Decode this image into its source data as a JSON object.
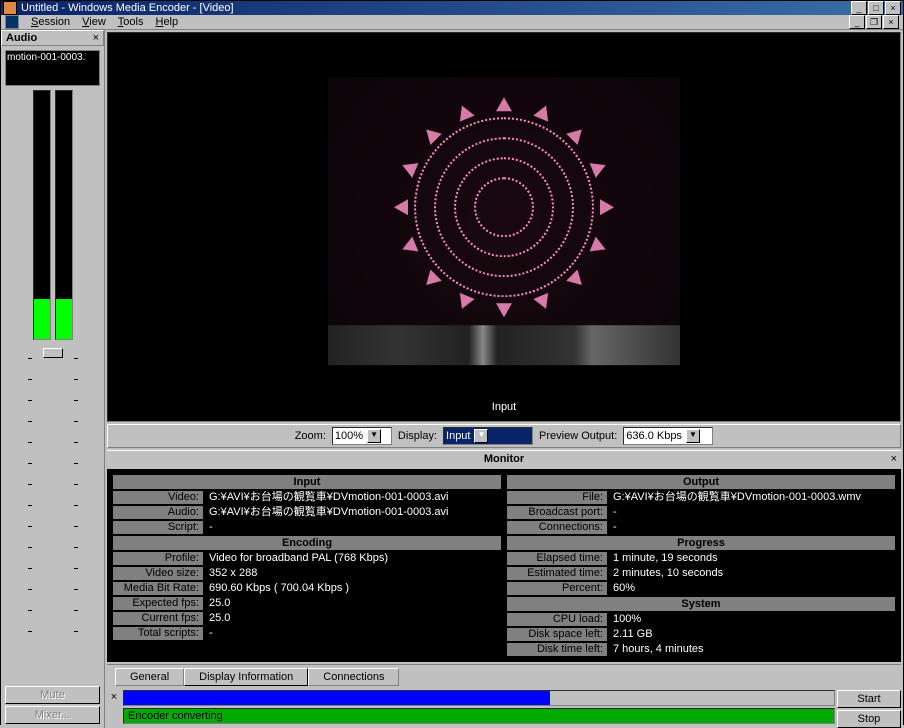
{
  "window": {
    "title": "Untitled - Windows Media Encoder - [Video]"
  },
  "menu": {
    "session": "Session",
    "view": "View",
    "tools": "Tools",
    "help": "Help"
  },
  "audio": {
    "header": "Audio",
    "thumb": "motion-001-0003.",
    "mute": "Mute",
    "mixer": "Mixer..."
  },
  "video": {
    "label": "Input"
  },
  "controls": {
    "zoom_label": "Zoom:",
    "zoom_value": "100%",
    "display_label": "Display:",
    "display_value": "Input",
    "preview_label": "Preview Output:",
    "preview_value": "636.0 Kbps"
  },
  "monitor": {
    "header": "Monitor",
    "input_hdr": "Input",
    "input": {
      "video_k": "Video:",
      "video_v": "G:¥AVI¥お台場の観覧車¥DVmotion-001-0003.avi",
      "audio_k": "Audio:",
      "audio_v": "G:¥AVI¥お台場の観覧車¥DVmotion-001-0003.avi",
      "script_k": "Script:",
      "script_v": "-"
    },
    "encoding_hdr": "Encoding",
    "encoding": {
      "profile_k": "Profile:",
      "profile_v": "Video for broadband PAL (768 Kbps)",
      "size_k": "Video size:",
      "size_v": "352 x 288",
      "bitrate_k": "Media Bit Rate:",
      "bitrate_v": "690.60 Kbps ( 700.04 Kbps )",
      "expfps_k": "Expected fps:",
      "expfps_v": "25.0",
      "curfps_k": "Current fps:",
      "curfps_v": "25.0",
      "scripts_k": "Total scripts:",
      "scripts_v": "-"
    },
    "output_hdr": "Output",
    "output": {
      "file_k": "File:",
      "file_v": "G:¥AVI¥お台場の観覧車¥DVmotion-001-0003.wmv",
      "port_k": "Broadcast port:",
      "port_v": "-",
      "conn_k": "Connections:",
      "conn_v": "-"
    },
    "progress_hdr": "Progress",
    "progress": {
      "elapsed_k": "Elapsed time:",
      "elapsed_v": "1 minute, 19 seconds",
      "est_k": "Estimated time:",
      "est_v": "2 minutes, 10 seconds",
      "pct_k": "Percent:",
      "pct_v": "60%"
    },
    "system_hdr": "System",
    "system": {
      "cpu_k": "CPU load:",
      "cpu_v": "100%",
      "disk_k": "Disk space left:",
      "disk_v": "2.11 GB",
      "dtime_k": "Disk time left:",
      "dtime_v": "7 hours, 4 minutes"
    }
  },
  "tabs": {
    "general": "General",
    "display": "Display Information",
    "connections": "Connections"
  },
  "status": {
    "text": "Encoder converting"
  },
  "buttons": {
    "start": "Start",
    "stop": "Stop"
  }
}
